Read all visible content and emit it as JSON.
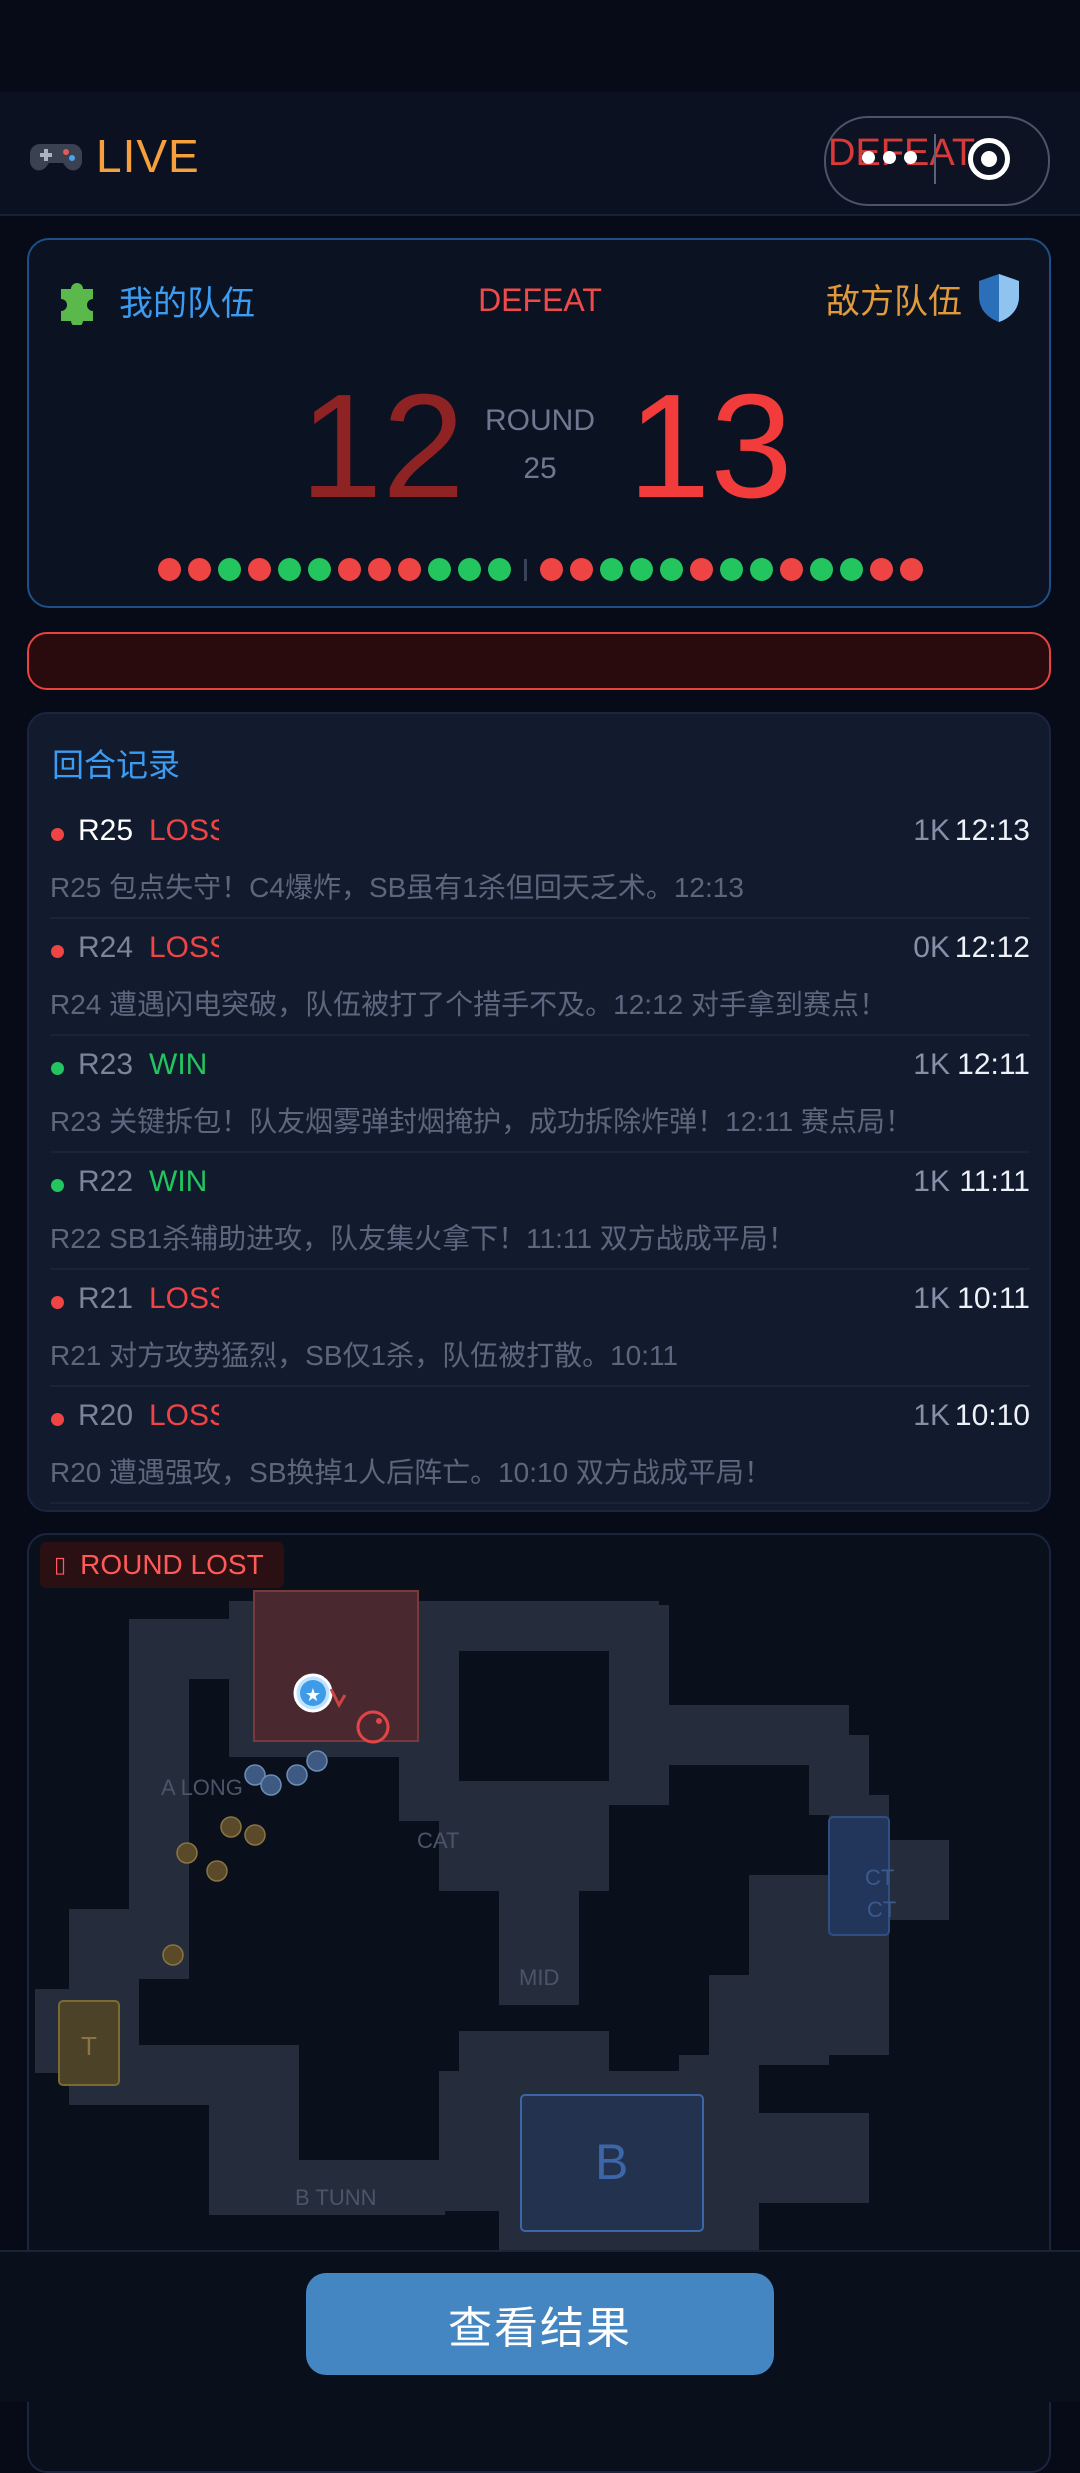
{
  "header": {
    "live_label": "LIVE",
    "capsule_text": "DEFEAT"
  },
  "score": {
    "my_team": "我的队伍",
    "enemy_team": "敌方队伍",
    "result": "DEFEAT",
    "my_score": "12",
    "enemy_score": "13",
    "round_label": "ROUND",
    "round_number": "25",
    "round_history": [
      "L",
      "L",
      "W",
      "L",
      "W",
      "W",
      "L",
      "L",
      "L",
      "W",
      "W",
      "W",
      "L",
      "L",
      "W",
      "W",
      "W",
      "L",
      "W",
      "W",
      "L",
      "W",
      "W",
      "L",
      "L"
    ],
    "colors": {
      "win": "#22c55e",
      "loss": "#ef4444"
    }
  },
  "round_log": {
    "title": "回合记录",
    "rows": [
      {
        "round": "R25",
        "result": "LOSS",
        "kills": "1K",
        "time": "12:13",
        "desc": "R25 包点失守！C4爆炸，SB虽有1杀但回天乏术。12:13"
      },
      {
        "round": "R24",
        "result": "LOSS",
        "kills": "0K",
        "time": "12:12",
        "desc": "R24 遭遇闪电突破，队伍被打了个措手不及。12:12 对手拿到赛点！"
      },
      {
        "round": "R23",
        "result": "WIN",
        "kills": "1K",
        "time": "12:11",
        "desc": "R23 关键拆包！队友烟雾弹封烟掩护，成功拆除炸弹！12:11 赛点局！"
      },
      {
        "round": "R22",
        "result": "WIN",
        "kills": "1K",
        "time": "11:11",
        "desc": "R22 SB1杀辅助进攻，队友集火拿下！11:11 双方战成平局！"
      },
      {
        "round": "R21",
        "result": "LOSS",
        "kills": "1K",
        "time": "10:11",
        "desc": "R21 对方攻势猛烈，SB仅1杀，队伍被打散。10:11"
      },
      {
        "round": "R20",
        "result": "LOSS",
        "kills": "1K",
        "time": "10:10",
        "desc": "R20 遭遇强攻，SB换掉1人后阵亡。10:10 双方战成平局！"
      }
    ]
  },
  "map": {
    "badge_text": "ROUND LOST",
    "zones": {
      "a_long": "A LONG",
      "cat": "CAT",
      "mid": "MID",
      "b_tunn": "B TUNN",
      "ct": "CT",
      "t": "T",
      "b_site": "B"
    }
  },
  "action": {
    "view_result": "查看结果"
  }
}
